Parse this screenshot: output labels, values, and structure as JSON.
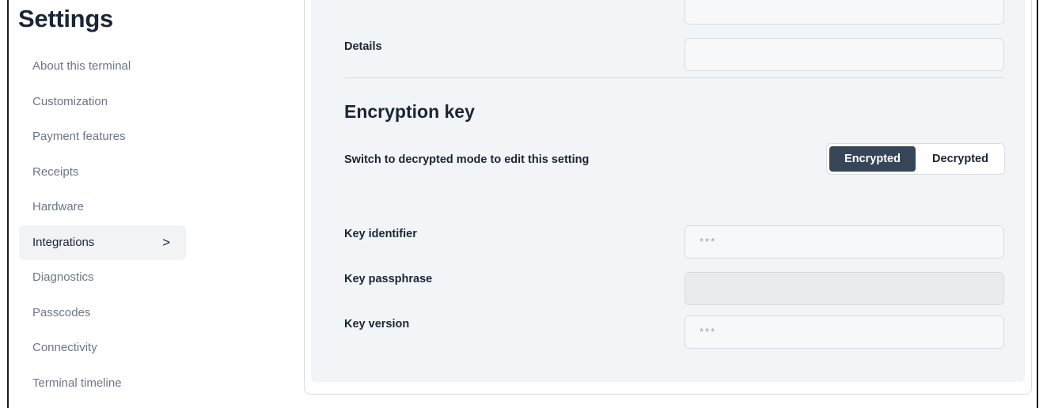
{
  "page": {
    "title": "Settings"
  },
  "sidebar": {
    "items": [
      {
        "label": "About this terminal"
      },
      {
        "label": "Customization"
      },
      {
        "label": "Payment features"
      },
      {
        "label": "Receipts"
      },
      {
        "label": "Hardware"
      },
      {
        "label": "Integrations",
        "active": true
      },
      {
        "label": "Diagnostics"
      },
      {
        "label": "Passcodes"
      },
      {
        "label": "Connectivity"
      },
      {
        "label": "Terminal timeline"
      }
    ],
    "active_chevron": ">"
  },
  "details": {
    "label": "Details",
    "value": ""
  },
  "encryption": {
    "title": "Encryption key",
    "switch_label": "Switch to decrypted mode to edit this setting",
    "toggle": {
      "encrypted": "Encrypted",
      "decrypted": "Decrypted",
      "selected": "Encrypted"
    },
    "key_identifier": {
      "label": "Key identifier",
      "value": "***"
    },
    "key_passphrase": {
      "label": "Key passphrase",
      "value": ""
    },
    "key_version": {
      "label": "Key version",
      "value": "***"
    }
  }
}
